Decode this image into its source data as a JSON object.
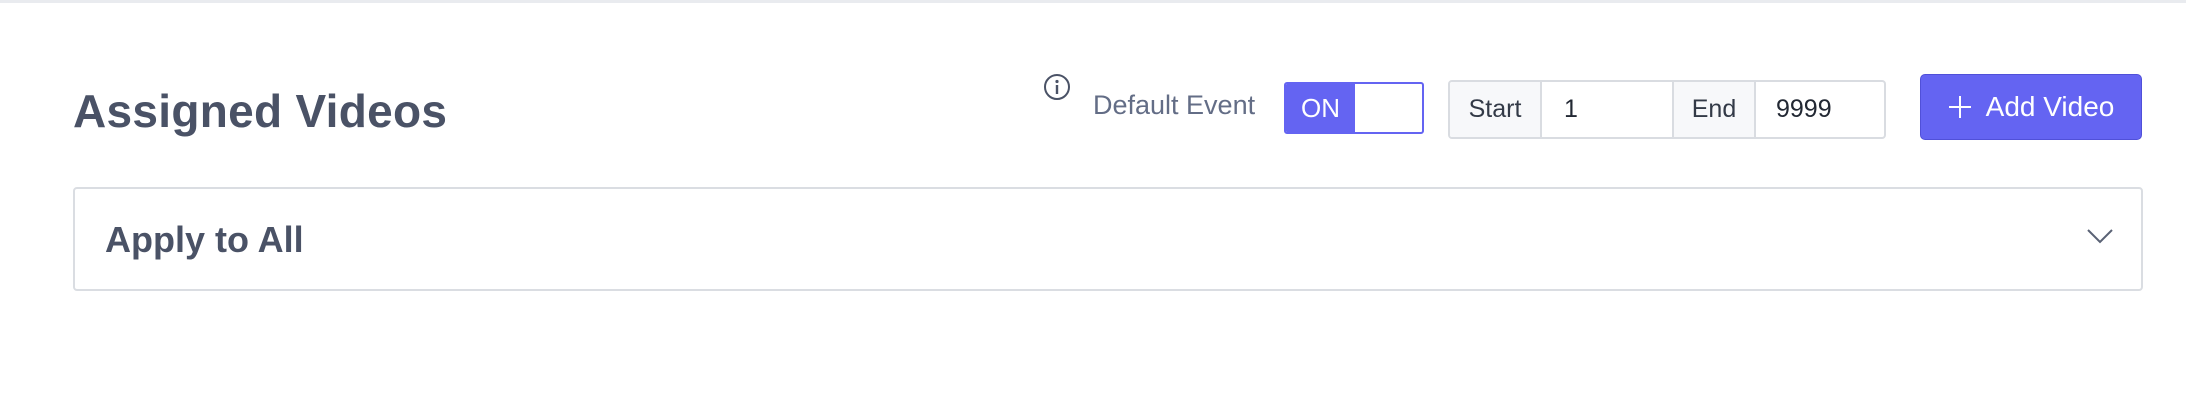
{
  "header": {
    "title": "Assigned Videos"
  },
  "controls": {
    "info_icon": "info-circle-icon",
    "default_event_label": "Default Event",
    "toggle": {
      "label": "ON",
      "state": true
    },
    "range": {
      "start_label": "Start",
      "start_value": "1",
      "end_label": "End",
      "end_value": "9999"
    },
    "add_button": {
      "label": "Add Video",
      "icon": "plus-icon"
    }
  },
  "panel": {
    "title": "Apply to All",
    "icon": "chevron-down-icon"
  },
  "colors": {
    "accent": "#6464f2",
    "heading": "#4a5266",
    "muted_text": "#636d86",
    "border": "#dadde2"
  }
}
